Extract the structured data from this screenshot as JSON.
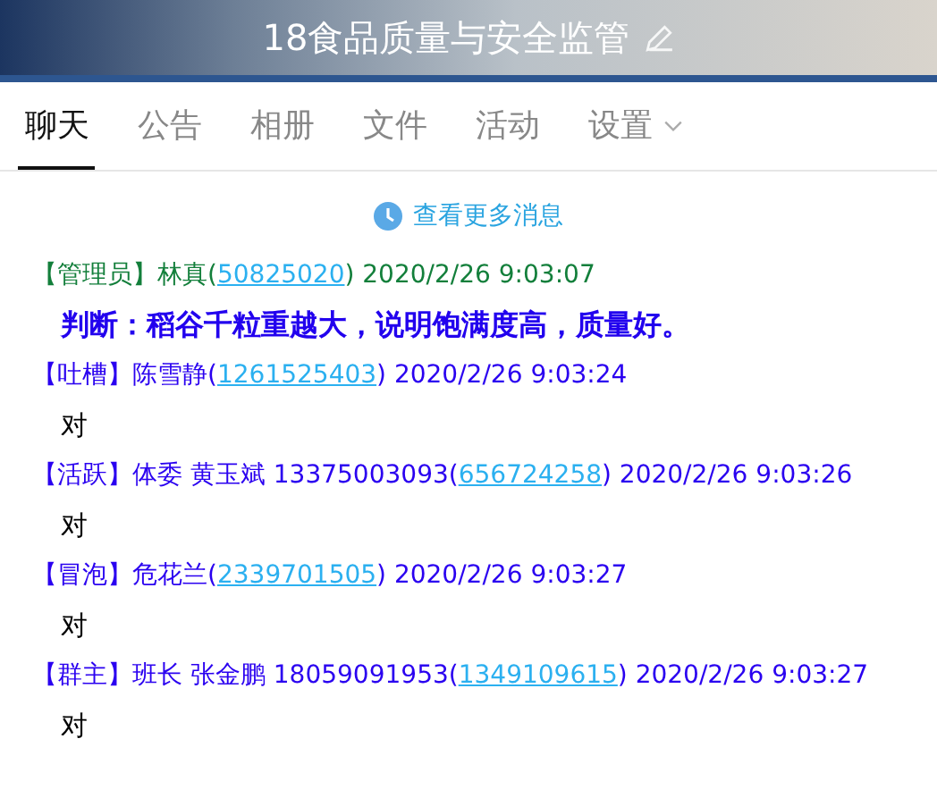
{
  "header": {
    "title": "18食品质量与安全监管"
  },
  "tabs": [
    {
      "label": "聊天",
      "selected": true
    },
    {
      "label": "公告",
      "selected": false
    },
    {
      "label": "相册",
      "selected": false
    },
    {
      "label": "文件",
      "selected": false
    },
    {
      "label": "活动",
      "selected": false
    },
    {
      "label": "设置",
      "selected": false,
      "dropdown": true
    }
  ],
  "more_link": "查看更多消息",
  "messages": [
    {
      "sender": "【管理员】林真(",
      "id": "50825020",
      "time": ") 2020/2/26 9:03:07",
      "color": "#137f3b",
      "kind": "bold",
      "body": "判断：稻谷千粒重越大，说明饱满度高，质量好。"
    },
    {
      "sender": "【吐槽】陈雪静(",
      "id": "1261525403",
      "time": ") 2020/2/26 9:03:24",
      "color": "#2a00f0",
      "kind": "plain",
      "body": "对"
    },
    {
      "sender": "【活跃】体委  黄玉斌  13375003093(",
      "id": "656724258",
      "time": ") 2020/2/26 9:03:26",
      "color": "#2a00f0",
      "kind": "plain",
      "body": "对"
    },
    {
      "sender": "【冒泡】危花兰(",
      "id": "2339701505",
      "time": ") 2020/2/26 9:03:27",
      "color": "#2a00f0",
      "kind": "plain",
      "body": "对"
    },
    {
      "sender": "【群主】班长 张金鹏 18059091953(",
      "id": "1349109615",
      "time": ") 2020/2/26 9:03:27",
      "color": "#2a00f0",
      "kind": "plain",
      "body": "对"
    }
  ]
}
